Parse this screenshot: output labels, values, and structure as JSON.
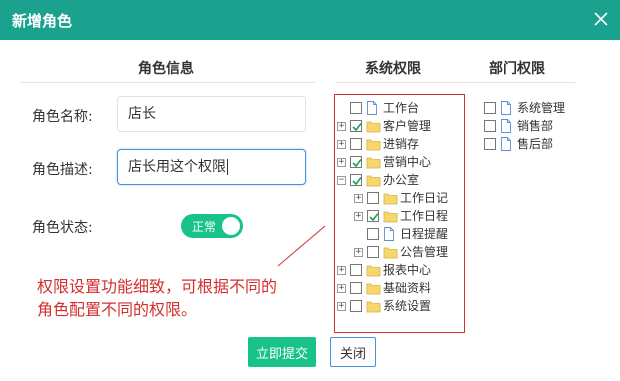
{
  "dialog": {
    "title": "新增角色",
    "close_icon": "close-icon"
  },
  "sections": {
    "role_info": "角色信息",
    "system_permissions": "系统权限",
    "dept_permissions": "部门权限"
  },
  "form": {
    "name_label": "角色名称:",
    "name_value": "店长",
    "desc_label": "角色描述:",
    "desc_value": "店长用这个权限",
    "status_label": "角色状态:",
    "status_value": "正常"
  },
  "system_tree": [
    {
      "label": "工作台",
      "icon": "file-icon",
      "checked": false,
      "expander": "none"
    },
    {
      "label": "客户管理",
      "icon": "folder-icon",
      "checked": true,
      "expander": "plus"
    },
    {
      "label": "进销存",
      "icon": "folder-icon",
      "checked": false,
      "expander": "plus"
    },
    {
      "label": "营销中心",
      "icon": "folder-icon",
      "checked": true,
      "expander": "plus"
    },
    {
      "label": "办公室",
      "icon": "folder-icon",
      "checked": true,
      "expander": "minus"
    },
    {
      "label": "工作日记",
      "icon": "folder-icon",
      "checked": false,
      "expander": "plus"
    },
    {
      "label": "工作日程",
      "icon": "folder-icon",
      "checked": true,
      "expander": "plus"
    },
    {
      "label": "日程提醒",
      "icon": "file-icon",
      "checked": false,
      "expander": "none"
    },
    {
      "label": "公告管理",
      "icon": "folder-icon",
      "checked": false,
      "expander": "plus"
    },
    {
      "label": "报表中心",
      "icon": "folder-icon",
      "checked": false,
      "expander": "plus"
    },
    {
      "label": "基础资料",
      "icon": "folder-icon",
      "checked": false,
      "expander": "plus"
    },
    {
      "label": "系统设置",
      "icon": "folder-icon",
      "checked": false,
      "expander": "plus"
    }
  ],
  "dept_tree": [
    {
      "label": "系统管理",
      "icon": "file-icon",
      "checked": false
    },
    {
      "label": "销售部",
      "icon": "file-icon",
      "checked": false
    },
    {
      "label": "售后部",
      "icon": "file-icon",
      "checked": false
    }
  ],
  "annotation": {
    "line1": "权限设置功能细致，可根据不同的",
    "line2": "角色配置不同的权限。",
    "color": "#d32f2f"
  },
  "buttons": {
    "submit": "立即提交",
    "close": "关闭"
  },
  "colors": {
    "header": "#1aa28e",
    "primary": "#19c28b",
    "check": "#19a05a",
    "folder": "#f5d76e",
    "file": "#5b8fd8"
  }
}
